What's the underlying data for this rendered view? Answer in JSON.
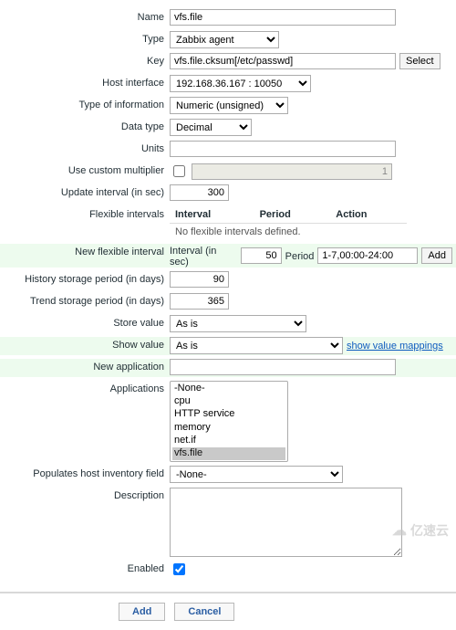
{
  "form": {
    "name_label": "Name",
    "name_value": "vfs.file",
    "type_label": "Type",
    "type_value": "Zabbix agent",
    "key_label": "Key",
    "key_value": "vfs.file.cksum[/etc/passwd]",
    "select_btn": "Select",
    "host_interface_label": "Host interface",
    "host_interface_value": "192.168.36.167 : 10050",
    "info_type_label": "Type of information",
    "info_type_value": "Numeric (unsigned)",
    "data_type_label": "Data type",
    "data_type_value": "Decimal",
    "units_label": "Units",
    "units_value": "",
    "multiplier_label": "Use custom multiplier",
    "multiplier_value": "1",
    "update_interval_label": "Update interval (in sec)",
    "update_interval_value": "300",
    "flex_intervals_label": "Flexible intervals",
    "flex_table": {
      "h_interval": "Interval",
      "h_period": "Period",
      "h_action": "Action",
      "empty": "No flexible intervals defined."
    },
    "new_flex_label": "New flexible interval",
    "new_flex_interval_label": "Interval (in sec)",
    "new_flex_interval_value": "50",
    "new_flex_period_label": "Period",
    "new_flex_period_value": "1-7,00:00-24:00",
    "add_small": "Add",
    "history_label": "History storage period (in days)",
    "history_value": "90",
    "trend_label": "Trend storage period (in days)",
    "trend_value": "365",
    "store_value_label": "Store value",
    "store_value_value": "As is",
    "show_value_label": "Show value",
    "show_value_value": "As is",
    "show_value_link": "show value mappings",
    "new_app_label": "New application",
    "new_app_value": "",
    "applications_label": "Applications",
    "applications_options": [
      "-None-",
      "cpu",
      "HTTP service",
      "memory",
      "net.if",
      "vfs.file"
    ],
    "inventory_label": "Populates host inventory field",
    "inventory_value": "-None-",
    "description_label": "Description",
    "description_value": "",
    "enabled_label": "Enabled"
  },
  "footer": {
    "add": "Add",
    "cancel": "Cancel"
  },
  "watermark": "亿速云"
}
